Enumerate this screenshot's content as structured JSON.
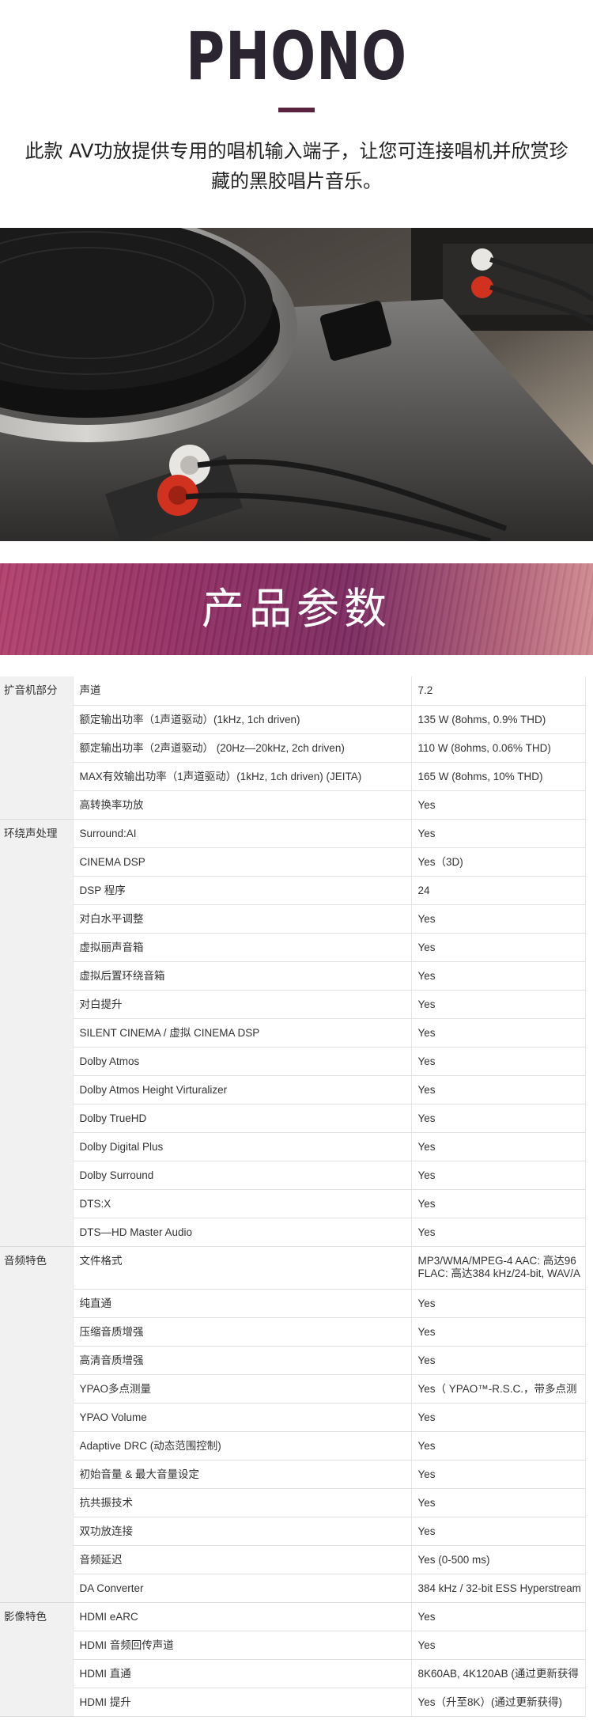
{
  "hero": {
    "title": "PHONO",
    "description": "此款 AV功放提供专用的唱机输入端子，让您可连接唱机并欣赏珍藏的黑胶唱片音乐。"
  },
  "banner": {
    "title": "产品参数"
  },
  "spec_groups": [
    {
      "category": "扩音机部分",
      "rows": [
        {
          "name": "声道",
          "value": "7.2"
        },
        {
          "name": "额定输出功率（1声道驱动）(1kHz, 1ch driven)",
          "value": "135 W (8ohms, 0.9% THD)"
        },
        {
          "name": "额定输出功率（2声道驱动） (20Hz—20kHz, 2ch driven)",
          "value": "110 W (8ohms, 0.06% THD)"
        },
        {
          "name": "MAX有效输出功率（1声道驱动）(1kHz, 1ch driven) (JEITA)",
          "value": "165 W (8ohms, 10% THD)"
        },
        {
          "name": "高转换率功放",
          "value": "Yes"
        }
      ]
    },
    {
      "category": "环绕声处理",
      "rows": [
        {
          "name": "Surround:AI",
          "value": "Yes"
        },
        {
          "name": "CINEMA DSP",
          "value": "Yes（3D)"
        },
        {
          "name": "DSP 程序",
          "value": "24"
        },
        {
          "name": "对白水平调整",
          "value": "Yes"
        },
        {
          "name": "虚拟丽声音箱",
          "value": "Yes"
        },
        {
          "name": "虚拟后置环绕音箱",
          "value": "Yes"
        },
        {
          "name": "对白提升",
          "value": "Yes"
        },
        {
          "name": "SILENT CINEMA / 虚拟 CINEMA DSP",
          "value": "Yes"
        },
        {
          "name": "Dolby Atmos",
          "value": "Yes"
        },
        {
          "name": "Dolby Atmos Height Virturalizer",
          "value": "Yes"
        },
        {
          "name": "Dolby TrueHD",
          "value": "Yes"
        },
        {
          "name": "Dolby Digital Plus",
          "value": "Yes"
        },
        {
          "name": "Dolby Surround",
          "value": "Yes"
        },
        {
          "name": "DTS:X",
          "value": "Yes"
        },
        {
          "name": "DTS—HD Master Audio",
          "value": "Yes"
        }
      ]
    },
    {
      "category": "音频特色",
      "rows": [
        {
          "name": "文件格式",
          "value": "MP3/WMA/MPEG-4 AAC: 高达96",
          "value2": "FLAC: 高达384 kHz/24-bit, WAV/A"
        },
        {
          "name": "纯直通",
          "value": "Yes"
        },
        {
          "name": "压缩音质增强",
          "value": "Yes"
        },
        {
          "name": "高清音质增强",
          "value": "Yes"
        },
        {
          "name": "YPAO多点测量",
          "value": "Yes（ YPAO™-R.S.C.，带多点测"
        },
        {
          "name": "YPAO Volume",
          "value": "Yes"
        },
        {
          "name": "Adaptive DRC (动态范围控制)",
          "value": "Yes"
        },
        {
          "name": "初始音量 & 最大音量设定",
          "value": "Yes"
        },
        {
          "name": "抗共振技术",
          "value": "Yes"
        },
        {
          "name": "双功放连接",
          "value": "Yes"
        },
        {
          "name": "音频延迟",
          "value": "Yes (0-500 ms)"
        },
        {
          "name": "DA Converter",
          "value": "384 kHz / 32-bit ESS Hyperstream"
        }
      ]
    },
    {
      "category": "影像特色",
      "rows": [
        {
          "name": "HDMI eARC",
          "value": "Yes"
        },
        {
          "name": "HDMI 音频回传声道",
          "value": "Yes"
        },
        {
          "name": "HDMI 直通",
          "value": "8K60AB, 4K120AB (通过更新获得"
        },
        {
          "name": "HDMI 提升",
          "value": "Yes（升至8K）(通过更新获得)"
        }
      ]
    }
  ]
}
